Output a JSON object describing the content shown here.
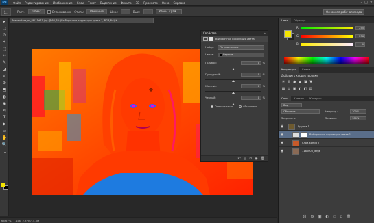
{
  "menubar": {
    "logo": "Ps",
    "items": [
      "Файл",
      "Редактирование",
      "Изображение",
      "Слои",
      "Текст",
      "Выделение",
      "Фильтр",
      "3D",
      "Просмотр",
      "Окно",
      "Справка"
    ],
    "window_controls": [
      "–",
      "□",
      "×"
    ]
  },
  "options": {
    "tool_glyph": "⬚",
    "feather_label": "Раст.:",
    "feather_value": "0 пикс",
    "antialias_label": "Сглаживание",
    "style_label": "Стиль:",
    "style_value": "Обычный",
    "width_label": "Шир.:",
    "height_label": "Выс.:",
    "refine_button": "Уточн. край...",
    "workspace": "Основная рабочая среда"
  },
  "tools": [
    "▸",
    "⬚",
    "ʘ",
    "⌖",
    "⬚",
    "✂",
    "✎",
    "◢",
    "✐",
    "⊕",
    "⬒",
    "◐",
    "◉",
    "✍",
    "T",
    "▶",
    "▭",
    "✋",
    "🔍",
    "…"
  ],
  "document": {
    "tab_label": "Maceratore_m_8f111d71.jpg @ 66,7% (Выборочная коррекция цвета 1, RGB/8#) *"
  },
  "properties": {
    "panel_title": "Свойства",
    "close": "»",
    "adjustment_title": "Выборочная коррекция цвета",
    "preset_label": "Набор:",
    "preset_value": "По умолчанию",
    "colors_label": "Цвета:",
    "colors_value": "Черные",
    "sliders": [
      {
        "label": "Голубой:",
        "value": "0",
        "unit": "%",
        "position": 0.5
      },
      {
        "label": "Пурпурный:",
        "value": "0",
        "unit": "%",
        "position": 0.5
      },
      {
        "label": "Желтый:",
        "value": "0",
        "unit": "%",
        "position": 0.5
      },
      {
        "label": "Черный:",
        "value": "0",
        "unit": "%",
        "position": 0.5
      }
    ],
    "method_relative": "Относительно",
    "method_absolute": "Абсолютно",
    "selected_method": "relative",
    "footer_icons": [
      "↶",
      "◎",
      "↺",
      "◉",
      "🗑"
    ]
  },
  "right": {
    "color_tabs": [
      "Цвет",
      "Образцы"
    ],
    "channels": [
      {
        "label": "R",
        "value": "255"
      },
      {
        "label": "G",
        "value": "236"
      },
      {
        "label": "B",
        "value": "0"
      }
    ],
    "foreground_color": "#f4e500",
    "adjust_tabs": [
      "Коррекция",
      "Стили"
    ],
    "adjust_title": "Добавить корректировку",
    "adjust_icons_row1": [
      "☀",
      "▥",
      "◑",
      "▲",
      "◪",
      "▼"
    ],
    "adjust_icons_row2": [
      "▦",
      "⚖",
      "▣",
      "◐",
      "◧",
      "▤"
    ],
    "layers_tabs": [
      "Слои",
      "Каналы",
      "Контуры"
    ],
    "kind_label": "Вид",
    "blend_mode": "Обычные",
    "opacity_label": "Непрозр.:",
    "opacity_value": "100%",
    "lock_label": "Закрепить:",
    "fill_label": "Заливка:",
    "fill_value": "100%",
    "layers": [
      {
        "name": "Группа 1",
        "kind": "group"
      },
      {
        "name": "Выборочная коррекция цвета 1",
        "kind": "adjustment",
        "selected": true
      },
      {
        "name": "Слой-копия 2",
        "kind": "photo"
      },
      {
        "name": "1180005_large",
        "kind": "photo"
      }
    ],
    "layer_footer_icons": [
      "⛓",
      "fx",
      "◙",
      "◐",
      "▭",
      "▫",
      "🗑"
    ]
  },
  "status": {
    "zoom": "66,67%",
    "doc_size": "Док: 2,37M/14,5M"
  }
}
